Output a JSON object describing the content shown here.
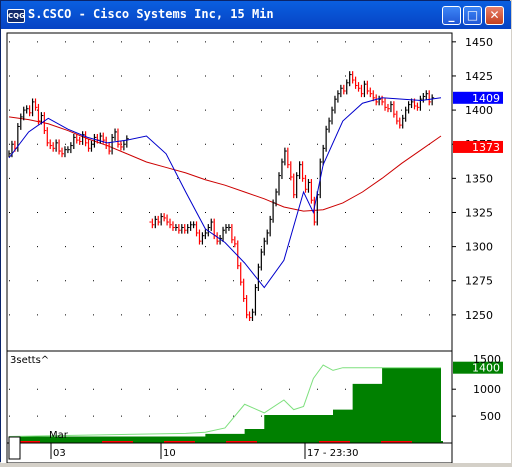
{
  "window": {
    "icon_label": "CQG",
    "title": "S.CSCO - Cisco Systems Inc, 15 Min",
    "minimize_label": "_",
    "maximize_label": "□",
    "close_label": "✕"
  },
  "colors": {
    "up": "#000000",
    "down": "#ff0000",
    "fast_ma": "#0000cc",
    "slow_ma": "#cc0000",
    "last_price_bg": "#0000ff",
    "slow_ma_bg": "#ff0000",
    "indicator_fill": "#008000",
    "indicator_line": "#7ee07e",
    "indicator_value_bg": "#008000"
  },
  "chart_data": [
    {
      "type": "line",
      "name": "price-panel",
      "ylim": [
        1225,
        1455
      ],
      "yticks": [
        1250,
        1275,
        1300,
        1325,
        1350,
        1375,
        1400,
        1425,
        1450
      ],
      "price_series": {
        "x": [
          0,
          3,
          6,
          9,
          12,
          15,
          18,
          21,
          24,
          27,
          30,
          33,
          36,
          39,
          42,
          45,
          48,
          51,
          54,
          57,
          60,
          63,
          66,
          69,
          72,
          75,
          78,
          81,
          84,
          87,
          90,
          93,
          96,
          99,
          102,
          105,
          108,
          111,
          114,
          117,
          120,
          143,
          146,
          149,
          152,
          155,
          158,
          161,
          164,
          167,
          170,
          173,
          176,
          179,
          182,
          185,
          188,
          191,
          194,
          197,
          200,
          203,
          206,
          209,
          212,
          215,
          218,
          221,
          224,
          227,
          230,
          233,
          236,
          239,
          242,
          245,
          248,
          251,
          254,
          257,
          260,
          263,
          266,
          269,
          272,
          275,
          278,
          281,
          284,
          287,
          290,
          293,
          296,
          299,
          302,
          305,
          308,
          311,
          314,
          317,
          320,
          323,
          326,
          329,
          332,
          335,
          338,
          341,
          344,
          347,
          350,
          353,
          356,
          359,
          362,
          365,
          368,
          371,
          374,
          377,
          380,
          383,
          386,
          389,
          392,
          395,
          398,
          401,
          404,
          407,
          410,
          413,
          416,
          419,
          422,
          425,
          428,
          431
        ],
        "close": [
          1368,
          1375,
          1372,
          1388,
          1395,
          1400,
          1401,
          1398,
          1406,
          1402,
          1392,
          1396,
          1385,
          1376,
          1374,
          1372,
          1376,
          1370,
          1368,
          1371,
          1371,
          1374,
          1380,
          1378,
          1377,
          1382,
          1376,
          1372,
          1375,
          1380,
          1378,
          1381,
          1378,
          1374,
          1370,
          1380,
          1384,
          1375,
          1373,
          1375,
          1379,
          1318,
          1316,
          1320,
          1318,
          1322,
          1321,
          1318,
          1316,
          1314,
          1314,
          1312,
          1314,
          1312,
          1314,
          1316,
          1316,
          1310,
          1304,
          1308,
          1310,
          1314,
          1318,
          1308,
          1304,
          1306,
          1312,
          1314,
          1314,
          1305,
          1302,
          1286,
          1274,
          1262,
          1250,
          1248,
          1252,
          1270,
          1285,
          1296,
          1304,
          1310,
          1320,
          1332,
          1340,
          1352,
          1362,
          1370,
          1360,
          1351,
          1338,
          1352,
          1360,
          1350,
          1342,
          1347,
          1334,
          1318,
          1338,
          1362,
          1372,
          1386,
          1392,
          1400,
          1408,
          1412,
          1416,
          1414,
          1420,
          1426,
          1422,
          1418,
          1416,
          1412,
          1419,
          1414,
          1412,
          1409,
          1406,
          1408,
          1406,
          1402,
          1401,
          1404,
          1397,
          1392,
          1389,
          1394,
          1400,
          1404,
          1406,
          1403,
          1402,
          1408,
          1410,
          1412,
          1406,
          1409
        ]
      },
      "fast_ma": {
        "x": [
          0,
          20,
          40,
          60,
          80,
          100,
          120,
          140,
          160,
          180,
          200,
          220,
          240,
          260,
          280,
          300,
          310,
          320,
          340,
          360,
          380,
          400,
          420,
          440
        ],
        "y": [
          1365,
          1384,
          1394,
          1386,
          1380,
          1376,
          1378,
          1381,
          1368,
          1340,
          1313,
          1303,
          1288,
          1270,
          1290,
          1340,
          1325,
          1360,
          1392,
          1405,
          1409,
          1408,
          1407,
          1409
        ]
      },
      "slow_ma": {
        "x": [
          0,
          20,
          40,
          60,
          80,
          100,
          120,
          140,
          160,
          180,
          200,
          220,
          240,
          260,
          280,
          300,
          320,
          340,
          360,
          380,
          400,
          420,
          440
        ],
        "y": [
          1395,
          1393,
          1390,
          1385,
          1379,
          1374,
          1368,
          1362,
          1358,
          1354,
          1349,
          1345,
          1340,
          1335,
          1329,
          1326,
          1327,
          1332,
          1340,
          1350,
          1361,
          1371,
          1381
        ]
      },
      "last_price_label": "1409",
      "slow_ma_label": "1373"
    },
    {
      "type": "area",
      "name": "3setts^",
      "title": "3setts^",
      "ylim": [
        0,
        1450
      ],
      "yticks": [
        500,
        1000
      ],
      "top_tick_label": "1500",
      "step_series": {
        "x": [
          0,
          60,
          120,
          160,
          200,
          240,
          260,
          300,
          330,
          350,
          380,
          410,
          440
        ],
        "y": [
          120,
          120,
          120,
          120,
          170,
          260,
          520,
          520,
          620,
          1100,
          1400,
          1400,
          1400
        ]
      },
      "line_series": {
        "x": [
          0,
          180,
          200,
          220,
          240,
          250,
          260,
          280,
          290,
          300,
          310,
          320,
          330,
          340,
          360,
          380,
          440
        ],
        "y": [
          120,
          180,
          200,
          280,
          720,
          640,
          560,
          800,
          620,
          680,
          1200,
          1450,
          1350,
          1400,
          1400,
          1400,
          1400
        ]
      },
      "value_label": "1400"
    }
  ],
  "time_axis": {
    "labels": [
      "Mar",
      "03",
      "10",
      "17 - 23:30"
    ]
  }
}
